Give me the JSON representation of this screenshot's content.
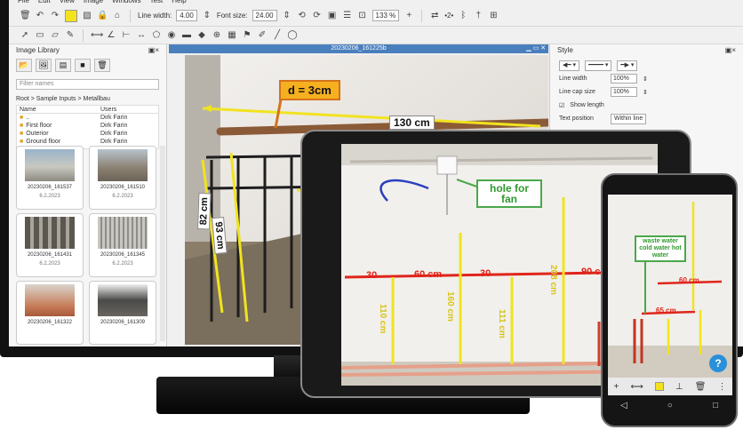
{
  "monitor": {
    "menu": [
      "File",
      "Edit",
      "View",
      "Image",
      "Windows",
      "Test",
      "Help"
    ],
    "toolbar": {
      "line_width_label": "Line width:",
      "line_width_value": "4.00",
      "font_size_label": "Font size:",
      "font_size_value": "24.00",
      "zoom": "133 %",
      "layer_label": "•2•"
    },
    "library": {
      "title": "Image Library",
      "filter_placeholder": "Filter names",
      "breadcrumb": "Root > Sample Inputs > Metallbau",
      "col_name": "Name",
      "col_users": "Users",
      "rows": [
        {
          "name": "..",
          "user": "Dirk Farin"
        },
        {
          "name": "First floor",
          "user": "Dirk Farin"
        },
        {
          "name": "Outerior",
          "user": "Dirk Farin"
        },
        {
          "name": "Ground floor",
          "user": "Dirk Farin"
        }
      ],
      "thumbs": [
        {
          "name": "20230206_161537",
          "date": "6.2.2023"
        },
        {
          "name": "20230206_161510",
          "date": "6.2.2023"
        },
        {
          "name": "20230206_161431",
          "date": "6.2.2023"
        },
        {
          "name": "20230206_161345",
          "date": "6.2.2023"
        },
        {
          "name": "20230206_161322",
          "date": ""
        },
        {
          "name": "20230206_161309",
          "date": ""
        }
      ]
    },
    "window": {
      "title": "20230206_161225b",
      "labels": {
        "diameter": "d = 3cm",
        "top": "130 cm",
        "left": "82 cm",
        "mid": "93 cm"
      }
    },
    "style": {
      "title": "Style",
      "line_width_label": "Line width",
      "line_width_value": "100%",
      "line_cap_label": "Line cap size",
      "line_cap_value": "100%",
      "show_length_label": "Show length",
      "text_position_label": "Text position",
      "text_position_value": "Within line"
    }
  },
  "tablet": {
    "labels": {
      "hole": "hole for fan",
      "d30a": "30",
      "d60": "60 cm",
      "d30b": "30",
      "d90": "90 cm",
      "v110": "110 cm",
      "v160": "160 cm",
      "v111": "111 cm",
      "v208": "208 cm"
    }
  },
  "phone": {
    "labels": {
      "water": "waste water cold water hot water",
      "d60": "60 cm",
      "d65": "65 cm"
    },
    "help": "?"
  }
}
